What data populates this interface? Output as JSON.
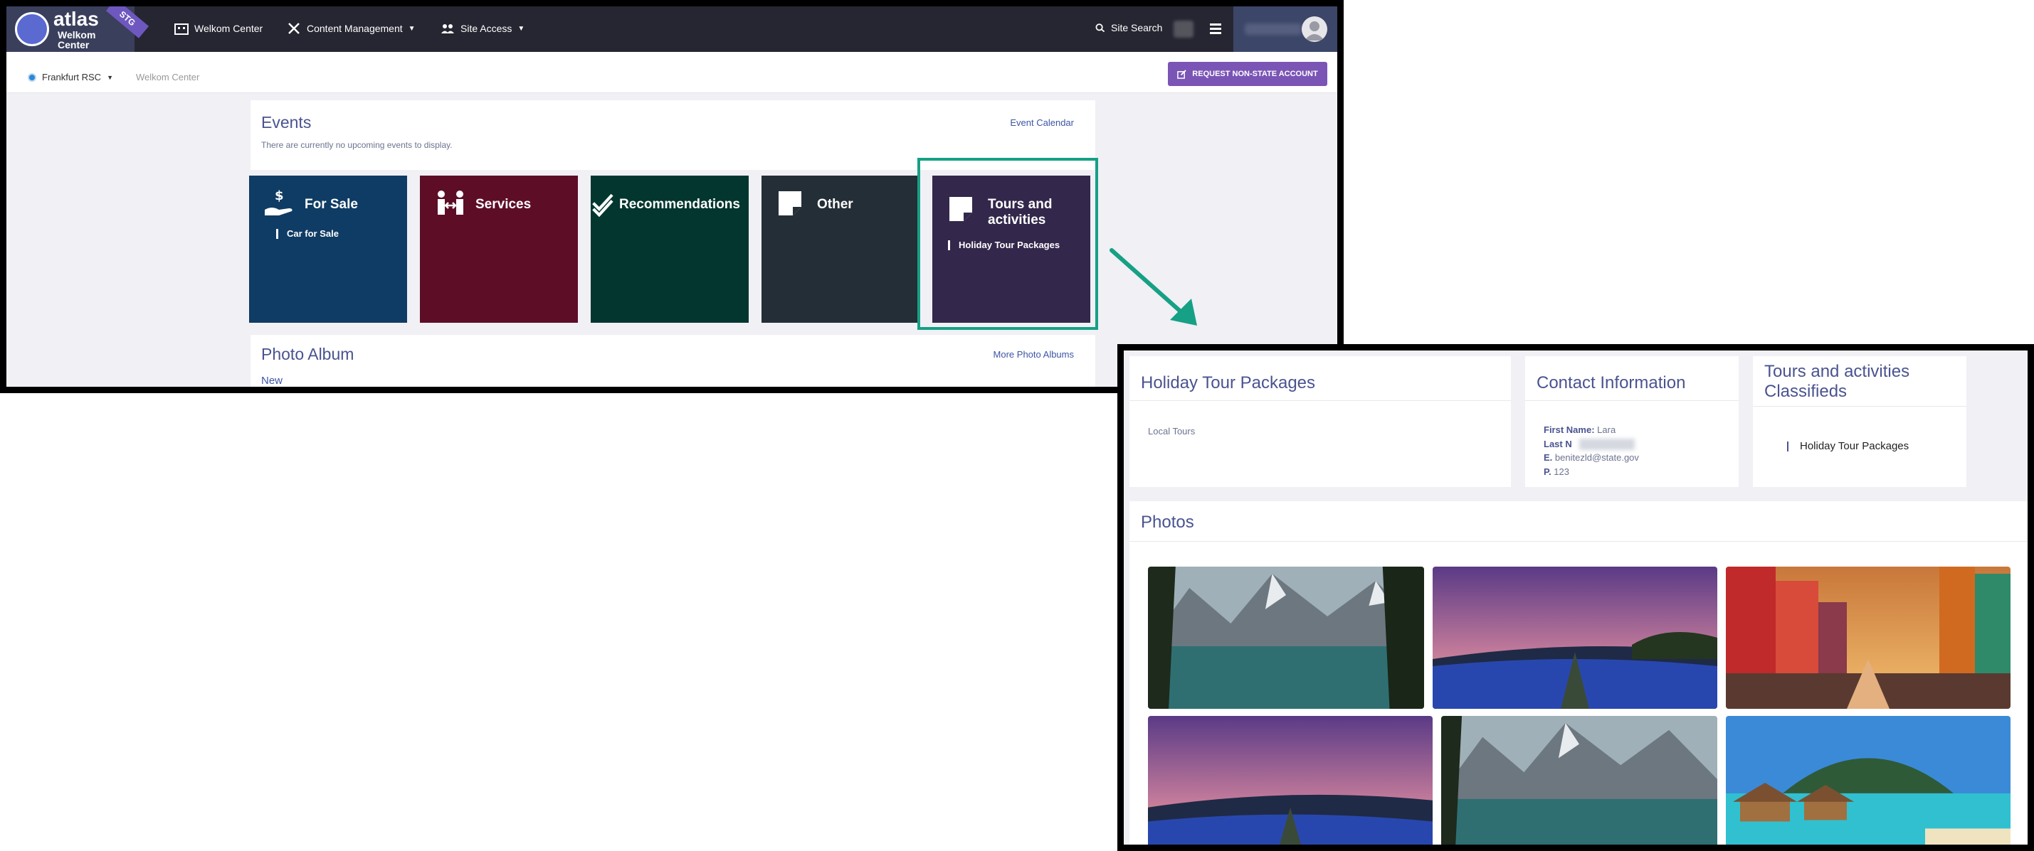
{
  "header": {
    "logo": {
      "brand": "atlas",
      "sub": "Welkom Center",
      "env_badge": "STG"
    },
    "nav": [
      {
        "label": "Welkom Center",
        "icon": "building-icon"
      },
      {
        "label": "Content Management",
        "icon": "tools-icon"
      },
      {
        "label": "Site Access",
        "icon": "users-icon"
      }
    ],
    "search_label": "Site Search"
  },
  "subbar": {
    "location": "Frankfurt RSC",
    "breadcrumb": "Welkom Center",
    "request_button": "REQUEST NON-STATE ACCOUNT"
  },
  "events": {
    "title": "Events",
    "empty_text": "There are currently no upcoming events to display.",
    "calendar_link": "Event Calendar"
  },
  "tiles": [
    {
      "label": "For Sale",
      "sub": "Car for Sale",
      "color": "#0f3c64",
      "icon": "hand-dollar-icon"
    },
    {
      "label": "Services",
      "sub": "",
      "color": "#5e0d27",
      "icon": "people-exchange-icon"
    },
    {
      "label": "Recommendations",
      "sub": "",
      "color": "#03362f",
      "icon": "double-check-icon"
    },
    {
      "label": "Other",
      "sub": "",
      "color": "#242e36",
      "icon": "note-icon"
    },
    {
      "label": "Tours and activities",
      "sub": "Holiday Tour Packages",
      "color": "#33274b",
      "icon": "note-icon"
    }
  ],
  "album": {
    "title": "Photo Album",
    "more_link": "More Photo Albums",
    "new_label": "New"
  },
  "detail": {
    "package": {
      "title": "Holiday Tour Packages",
      "tag": "Local Tours"
    },
    "contact": {
      "title": "Contact Information",
      "first_label": "First Name:",
      "first_value": "Lara",
      "last_label": "Last N",
      "email_label": "E.",
      "email_value": "benitezld@state.gov",
      "phone_label": "P.",
      "phone_value": "123"
    },
    "classifieds": {
      "title": "Tours and activities Classifieds",
      "item": "Holiday Tour Packages"
    },
    "photos": {
      "title": "Photos"
    }
  },
  "colors": {
    "topbar": "#262632",
    "accent_purple": "#7a55b5",
    "highlight": "#16a085",
    "heading": "#4a5390"
  }
}
